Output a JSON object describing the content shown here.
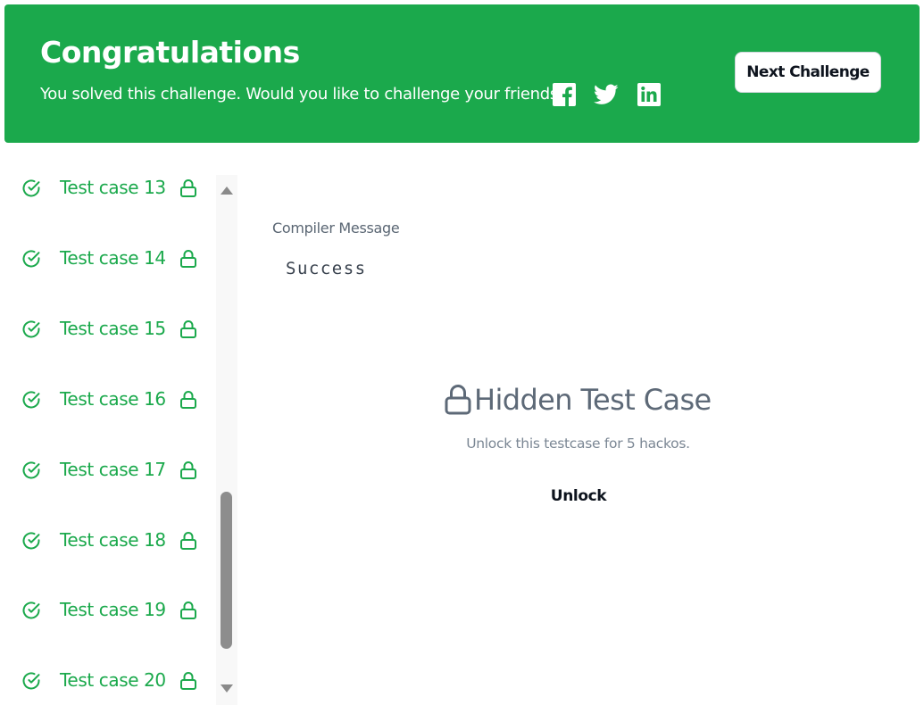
{
  "banner": {
    "title": "Congratulations",
    "subtitle": "You solved this challenge. Would you like to challenge your friends?",
    "social_icons": [
      "facebook-icon",
      "twitter-icon",
      "linkedin-icon"
    ],
    "next_button_label": "Next Challenge",
    "color": "#1ba94c"
  },
  "test_cases": {
    "status_color": "#1ba94c",
    "items": [
      {
        "label": "Test case 13",
        "status": "passed",
        "locked": true
      },
      {
        "label": "Test case 14",
        "status": "passed",
        "locked": true
      },
      {
        "label": "Test case 15",
        "status": "passed",
        "locked": true
      },
      {
        "label": "Test case 16",
        "status": "passed",
        "locked": true
      },
      {
        "label": "Test case 17",
        "status": "passed",
        "locked": true
      },
      {
        "label": "Test case 18",
        "status": "passed",
        "locked": true
      },
      {
        "label": "Test case 19",
        "status": "passed",
        "locked": true
      },
      {
        "label": "Test case 20",
        "status": "passed",
        "locked": true
      }
    ]
  },
  "result": {
    "compiler_message_label": "Compiler Message",
    "compiler_message_value": "Success",
    "hidden_title": "Hidden Test Case",
    "unlock_note": "Unlock this testcase for 5 hackos.",
    "unlock_button_label": "Unlock"
  }
}
